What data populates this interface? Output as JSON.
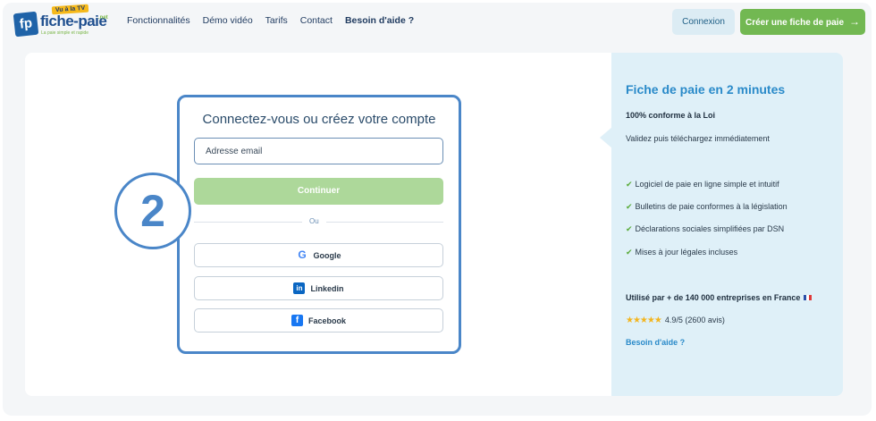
{
  "header": {
    "logo": {
      "badge": "fp",
      "name": "fiche-paie",
      "tv": "Vu à la TV",
      "suffix": ".net",
      "tagline": "La paie simple et rapide"
    },
    "nav": [
      "Fonctionnalités",
      "Démo vidéo",
      "Tarifs",
      "Contact",
      "Besoin d'aide ?"
    ],
    "login_label": "Connexion",
    "create_label": "Créer une fiche de paie",
    "create_arrow": "→"
  },
  "step_number": "2",
  "form": {
    "title": "Connectez-vous ou créez votre compte",
    "email_placeholder": "Adresse email",
    "continue_label": "Continuer",
    "or_label": "Ou",
    "google_label": "Google",
    "linkedin_label": "Linkedin",
    "facebook_label": "Facebook"
  },
  "sidebar": {
    "title": "Fiche de paie en 2 minutes",
    "subtitle": "100% conforme à la Loi",
    "description": "Validez puis téléchargez immédiatement",
    "check_glyph": "✔",
    "features": [
      "Logiciel de paie en ligne simple et intuitif",
      "Bulletins de paie conformes à la législation",
      "Déclarations sociales simplifiées par DSN",
      "Mises à jour légales incluses"
    ],
    "used_by": "Utilisé par + de 140 000 entreprises en France",
    "stars": "★★★★★",
    "rating": "4.9/5 (2600 avis)",
    "help_link": "Besoin d'aide ?"
  },
  "colors": {
    "accent_blue": "#2a8ac9",
    "green": "#72b852",
    "step_blue": "#4a86c8"
  }
}
